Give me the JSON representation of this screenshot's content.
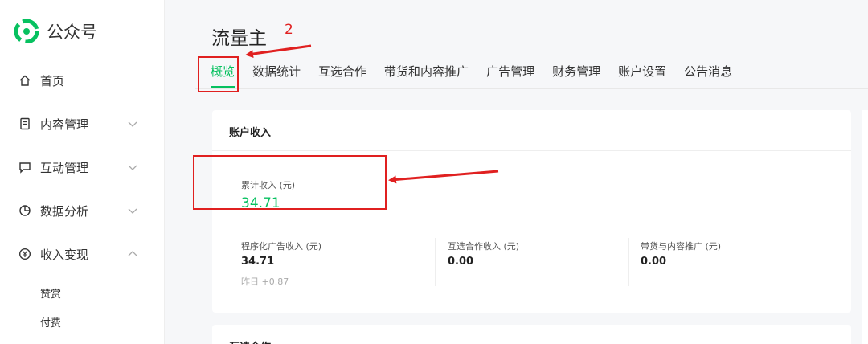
{
  "brand": {
    "name": "公众号"
  },
  "sidebar": {
    "items": [
      {
        "label": "首页",
        "icon": "home-icon"
      },
      {
        "label": "内容管理",
        "icon": "document-icon",
        "expand": "chevron-down"
      },
      {
        "label": "互动管理",
        "icon": "chat-icon",
        "expand": "chevron-down"
      },
      {
        "label": "数据分析",
        "icon": "pie-chart-icon",
        "expand": "chevron-down"
      },
      {
        "label": "收入变现",
        "icon": "yen-icon",
        "expand": "chevron-up"
      }
    ],
    "sub_items": [
      "赞赏",
      "付费"
    ]
  },
  "header": {
    "title": "流量主",
    "annotation": "2",
    "tabs": [
      "概览",
      "数据统计",
      "互选合作",
      "带货和内容推广",
      "广告管理",
      "财务管理",
      "账户设置",
      "公告消息"
    ],
    "active_tab": "概览"
  },
  "income_card": {
    "title": "账户收入",
    "total_label": "累计收入 (元)",
    "total_value": "34.71",
    "stats": [
      {
        "label": "程序化广告收入 (元)",
        "value": "34.71",
        "sub": "昨日 +0.87"
      },
      {
        "label": "互选合作收入 (元)",
        "value": "0.00"
      },
      {
        "label": "带货与内容推广 (元)",
        "value": "0.00"
      }
    ]
  },
  "second_card": {
    "title": "互选合作"
  },
  "colors": {
    "accent": "#07c160",
    "annotation": "#e02020"
  }
}
